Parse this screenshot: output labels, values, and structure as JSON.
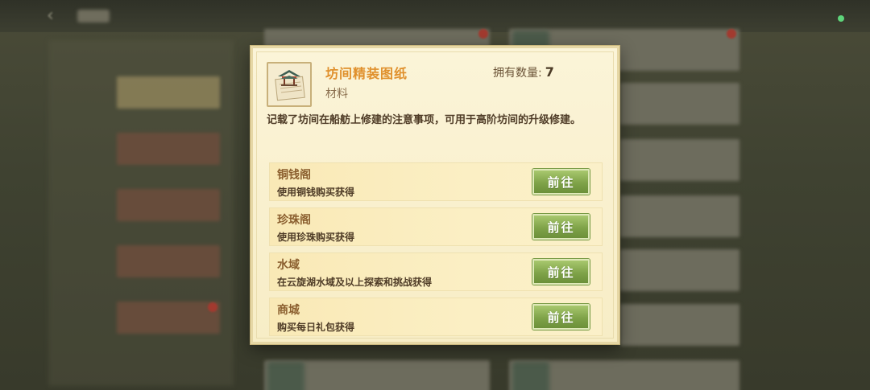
{
  "item": {
    "title": "坊间精装图纸",
    "category": "材料",
    "count_label": "拥有数量:",
    "count_value": "7",
    "description": "记载了坊间在船舫上修建的注意事项，可用于高阶坊间的升级修建。",
    "icon": "blueprint-pavilion-icon"
  },
  "sources": [
    {
      "name": "铜钱阁",
      "desc": "使用铜钱购买获得",
      "button": "前往"
    },
    {
      "name": "珍珠阁",
      "desc": "使用珍珠购买获得",
      "button": "前往"
    },
    {
      "name": "水域",
      "desc": "在云旋湖水域及以上探索和挑战获得",
      "button": "前往"
    },
    {
      "name": "商城",
      "desc": "购买每日礼包获得",
      "button": "前往"
    }
  ],
  "colors": {
    "title": "#e0902c",
    "button_green": "#7fa349",
    "modal_bg": "#fbf4d8",
    "status_dot": "#5ed47a"
  }
}
